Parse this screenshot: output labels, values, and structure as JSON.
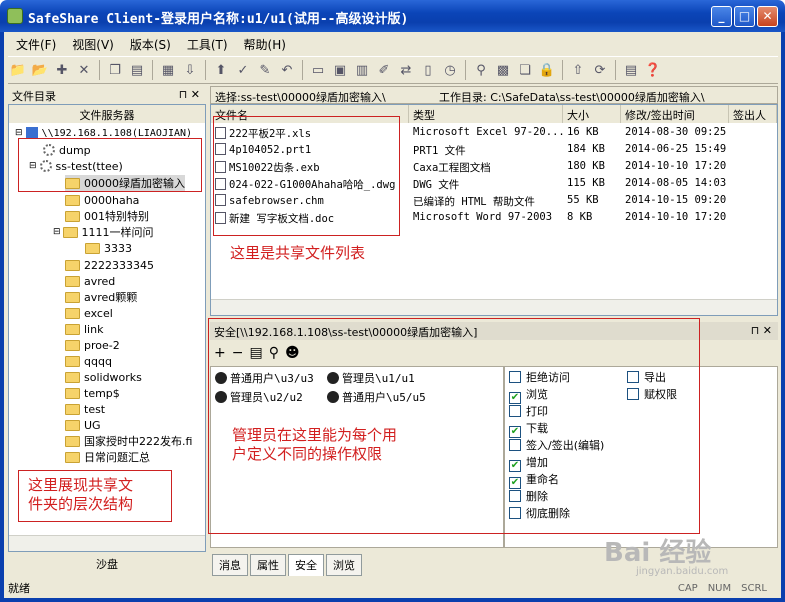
{
  "window": {
    "title": "SafeShare Client-登录用户名称:u1/u1(试用--高级设计版)",
    "controls": {
      "minimize": "_",
      "maximize": "□",
      "close": "✕"
    }
  },
  "menu": [
    "文件(F)",
    "视图(V)",
    "版本(S)",
    "工具(T)",
    "帮助(H)"
  ],
  "left_pane": {
    "header": "文件目录",
    "pin": "⊓ ✕",
    "server_label": "文件服务器",
    "tree": [
      {
        "label": "\\\\192.168.1.108(LIAOJIAN)",
        "kind": "server"
      },
      {
        "label": "dump",
        "kind": "share"
      },
      {
        "label": "ss-test(ttee)",
        "kind": "share"
      },
      {
        "label": "00000绿盾加密输入",
        "kind": "folder"
      },
      {
        "label": "0000haha",
        "kind": "folder"
      },
      {
        "label": "001特别特别",
        "kind": "folder"
      },
      {
        "label": "1111一样问问",
        "kind": "folder"
      },
      {
        "label": "3333",
        "kind": "folder"
      },
      {
        "label": "2222333345",
        "kind": "folder"
      },
      {
        "label": "avred",
        "kind": "folder"
      },
      {
        "label": "avred颗颗",
        "kind": "folder"
      },
      {
        "label": "excel",
        "kind": "folder"
      },
      {
        "label": "link",
        "kind": "folder"
      },
      {
        "label": "proe-2",
        "kind": "folder"
      },
      {
        "label": "qqqq",
        "kind": "folder"
      },
      {
        "label": "solidworks",
        "kind": "folder"
      },
      {
        "label": "temp$",
        "kind": "folder"
      },
      {
        "label": "test",
        "kind": "folder"
      },
      {
        "label": "UG",
        "kind": "folder"
      },
      {
        "label": "国家授时中222发布.fi",
        "kind": "folder"
      },
      {
        "label": "日常问题汇总",
        "kind": "folder"
      }
    ],
    "annotation": "这里展现共享文\n件夹的层次结构",
    "bottom_label": "沙盘"
  },
  "file_pane": {
    "selection_label": "选择:ss-test\\00000绿盾加密输入\\",
    "workdir_label": "工作目录: C:\\SafeData\\ss-test\\00000绿盾加密输入\\",
    "columns": [
      "文件名",
      "类型",
      "大小",
      "修改/签出时间",
      "签出人"
    ],
    "rows": [
      {
        "name": "222平板2平.xls",
        "type": "Microsoft Excel 97-20...",
        "size": "16 KB",
        "time": "2014-08-30 09:25",
        "by": ""
      },
      {
        "name": "4p104052.prt1",
        "type": "PRT1 文件",
        "size": "184 KB",
        "time": "2014-06-25 15:49",
        "by": ""
      },
      {
        "name": "MS10022齿条.exb",
        "type": "Caxa工程图文档",
        "size": "180 KB",
        "time": "2014-10-10 17:20",
        "by": ""
      },
      {
        "name": "024-022-G1000Ahaha哈哈_.dwg",
        "type": "DWG 文件",
        "size": "115 KB",
        "time": "2014-08-05 14:03",
        "by": ""
      },
      {
        "name": "safebrowser.chm",
        "type": "已编译的 HTML 帮助文件",
        "size": "55 KB",
        "time": "2014-10-15 09:20",
        "by": ""
      },
      {
        "name": "新建 写字板文档.doc",
        "type": "Microsoft Word 97-2003",
        "size": "8 KB",
        "time": "2014-10-10 17:20",
        "by": ""
      }
    ],
    "annotation": "这里是共享文件列表"
  },
  "security_pane": {
    "header": "安全[\\\\192.168.1.108\\ss-test\\00000绿盾加密输入]",
    "pin": "⊓ ✕",
    "toolbar": [
      "+",
      "−",
      "▤",
      "⚲",
      "☻"
    ],
    "users": [
      "普通用户\\u3/u3",
      "管理员\\u1/u1",
      "管理员\\u2/u2",
      "普通用户\\u5/u5"
    ],
    "permissions_left": [
      {
        "label": "拒绝访问",
        "checked": false
      },
      {
        "label": "浏览",
        "checked": true
      },
      {
        "label": "打印",
        "checked": false
      },
      {
        "label": "下载",
        "checked": true
      },
      {
        "label": "签入/签出(编辑)",
        "checked": false
      },
      {
        "label": "增加",
        "checked": true
      },
      {
        "label": "重命名",
        "checked": true
      },
      {
        "label": "删除",
        "checked": false
      },
      {
        "label": "彻底删除",
        "checked": false
      }
    ],
    "permissions_right": [
      {
        "label": "导出",
        "checked": false
      },
      {
        "label": "赋权限",
        "checked": false
      }
    ],
    "annotation": "管理员在这里能为每个用\n户定义不同的操作权限"
  },
  "bottom_tabs": [
    {
      "label": "消息",
      "active": false
    },
    {
      "label": "属性",
      "active": false
    },
    {
      "label": "安全",
      "active": true
    },
    {
      "label": "浏览",
      "active": false
    }
  ],
  "status": {
    "text": "就绪",
    "indicators": [
      "CAP",
      "NUM",
      "SCRL"
    ]
  },
  "watermark": {
    "logo": "Bai  经验",
    "url": "jingyan.baidu.com"
  },
  "colors": {
    "annotation_red": "#d21f1f",
    "title_blue": "#0a3fae",
    "chrome": "#ece9d8"
  }
}
